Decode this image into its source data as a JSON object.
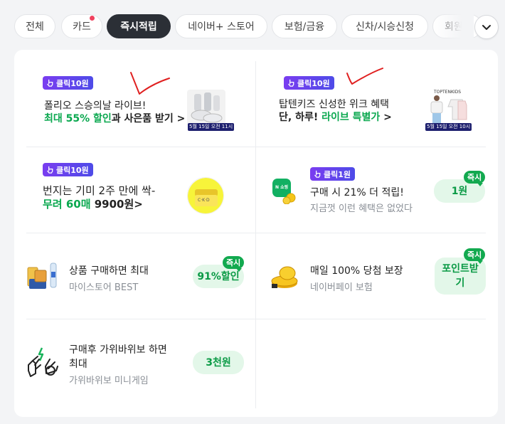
{
  "tabs": [
    {
      "label": "전체"
    },
    {
      "label": "카드"
    },
    {
      "label": "즉시적립"
    },
    {
      "label": "네이버+ 스토어"
    },
    {
      "label": "보험/금융"
    },
    {
      "label": "신차/시승신청"
    },
    {
      "label": "회원"
    }
  ],
  "cards": {
    "c1": {
      "badge": "클릭10원",
      "line1": "폴리오 스승의날 라이브!",
      "line2_green": "최대 55% 할인",
      "line2_rest": "과 사은품 받기 >",
      "date_tag": "5월 15일 오전 11시"
    },
    "c2": {
      "badge": "클릭10원",
      "line1": "탑텐키즈 신성한 위크 혜택",
      "line2_pre": "단, 하루! ",
      "line2_green": "라이브 특별가",
      "line2_post": " >",
      "thumb_logo": "TOPTENKIDS",
      "date_tag": "5월 15일 오전 10시"
    },
    "c3": {
      "badge": "클릭10원",
      "line1": "번지는 기미 2주 만에 싹-",
      "line2_green": "무려 60매",
      "line2_rest": " 9900원>",
      "thumb_text": "C·K·D"
    },
    "c4": {
      "badge": "클릭1원",
      "title": "구매 시 21% 더 적립!",
      "sub": "지금껏 이런 혜택은 없었다",
      "reward": "1원",
      "instant": "즉시",
      "icon_text": "N 쇼핑"
    },
    "c5": {
      "title": "상품 구매하면 최대",
      "sub": "마이스토어 BEST",
      "reward": "91%할인",
      "instant": "즉시"
    },
    "c6": {
      "title": "매일 100% 당첨 보장",
      "sub": "네이버페이 보험",
      "reward_line1": "포인트받",
      "reward_line2": "기",
      "instant": "즉시"
    },
    "c7": {
      "title_line1": "구매후 가위바위보 하면",
      "title_line2": "최대",
      "sub": "가위바위보 미니게임",
      "reward": "3천원"
    }
  },
  "icons": {
    "more": "chevron-down-icon",
    "badge": "hand-pointer-icon"
  },
  "colors": {
    "active_tab": "#2b2f36",
    "green": "#0aa84f",
    "badge_purple": "#6f42e8",
    "notification_dot": "#f0415e",
    "annotation_red": "#e02020"
  }
}
